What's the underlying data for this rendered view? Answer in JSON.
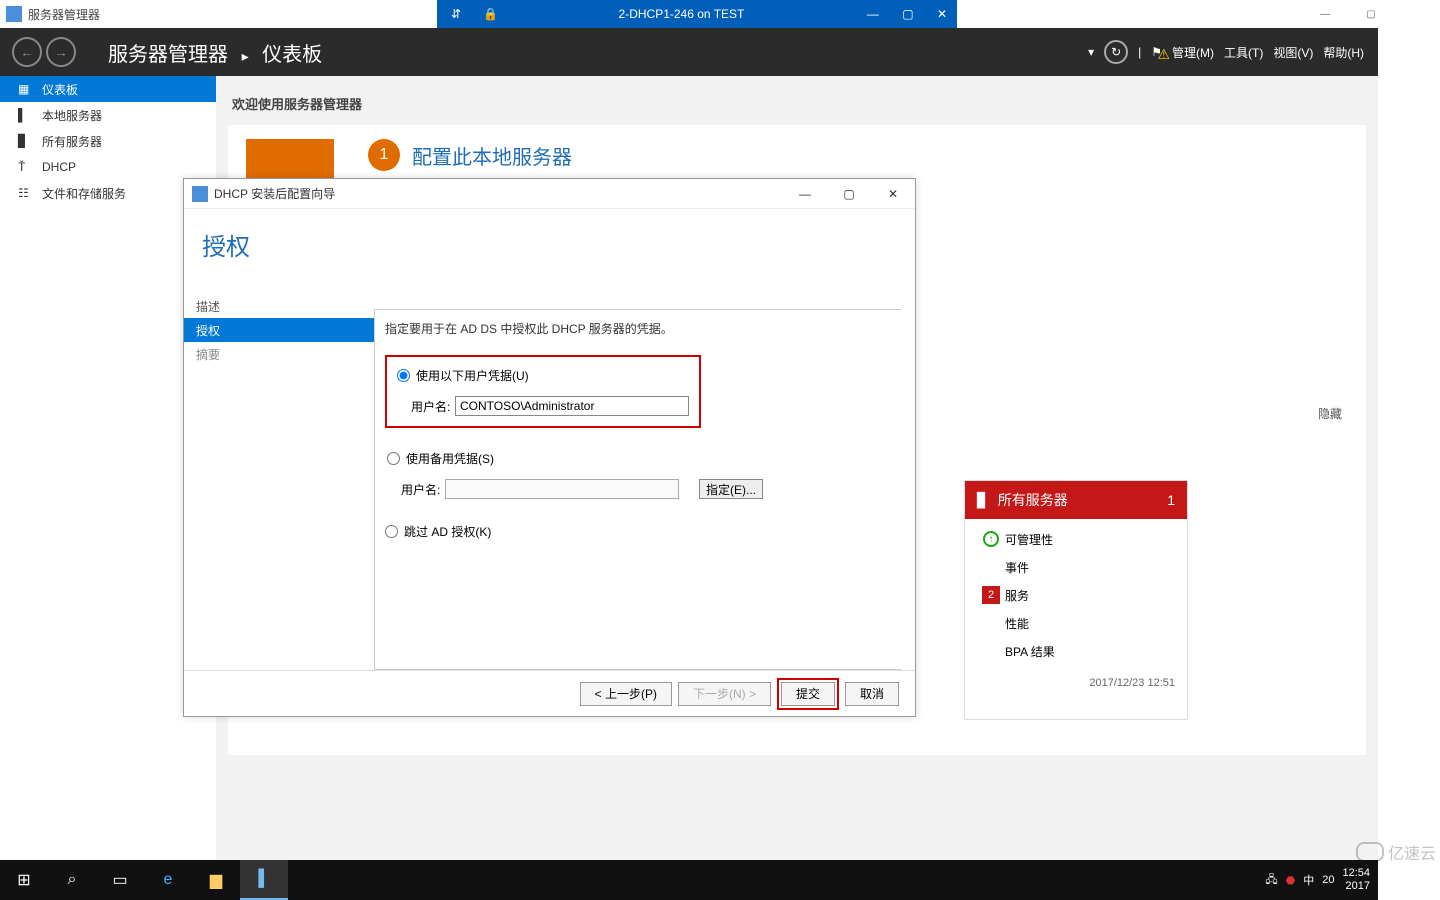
{
  "vm_bar": {
    "title": "2-DHCP1-246 on TEST"
  },
  "app": {
    "title": "服务器管理器"
  },
  "header": {
    "breadcrumb_root": "服务器管理器",
    "breadcrumb_page": "仪表板",
    "menu": {
      "manage": "管理(M)",
      "tools": "工具(T)",
      "view": "视图(V)",
      "help": "帮助(H)"
    }
  },
  "sidebar": {
    "items": [
      {
        "label": "仪表板",
        "active": true
      },
      {
        "label": "本地服务器"
      },
      {
        "label": "所有服务器"
      },
      {
        "label": "DHCP"
      },
      {
        "label": "文件和存储服务",
        "has_children": true
      }
    ]
  },
  "main": {
    "welcome": "欢迎使用服务器管理器",
    "step1_num": "1",
    "step1_text": "配置此本地服务器",
    "hide": "隐藏"
  },
  "dialog": {
    "title": "DHCP 安装后配置向导",
    "heading": "授权",
    "steps": {
      "s0": "描述",
      "s1": "授权",
      "s2": "摘要"
    },
    "desc": "指定要用于在 AD DS 中授权此 DHCP 服务器的凭据。",
    "opt1": "使用以下用户凭据(U)",
    "user_label": "用户名:",
    "user_value": "CONTOSO\\Administrator",
    "opt2": "使用备用凭据(S)",
    "specify": "指定(E)...",
    "opt3": "跳过 AD 授权(K)",
    "btn_prev": "< 上一步(P)",
    "btn_next": "下一步(N) >",
    "btn_commit": "提交",
    "btn_cancel": "取消"
  },
  "tile_all": {
    "title": "所有服务器",
    "count": "1",
    "rows": {
      "r0": "可管理性",
      "r1": "事件",
      "r2_badge": "2",
      "r2": "服务",
      "r3": "性能",
      "r4": "BPA 结果"
    },
    "timestamp": "2017/12/23 12:51"
  },
  "peek": {
    "count": "1",
    "time": "2:51"
  },
  "taskbar": {
    "tray_ime": "中",
    "tray_net": "20",
    "time": "12:54",
    "date": "2017"
  },
  "watermark": "亿速云"
}
